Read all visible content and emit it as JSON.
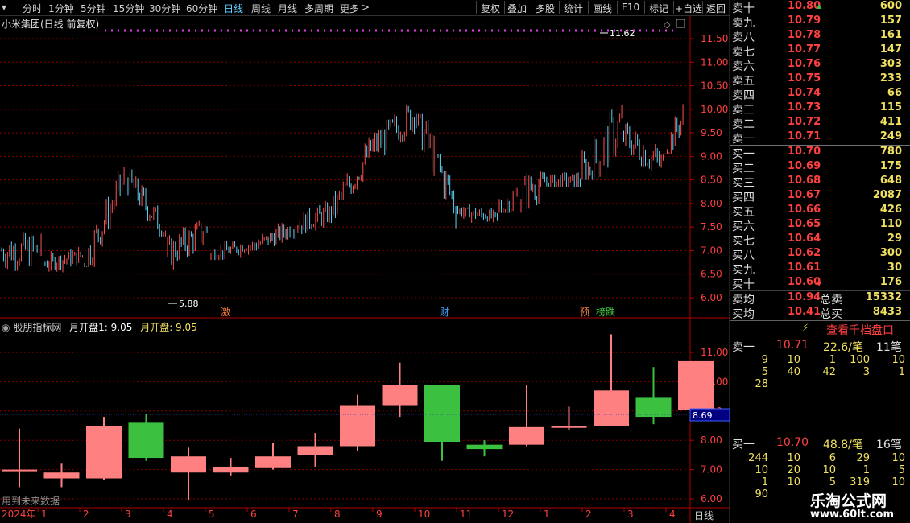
{
  "toolbar": {
    "periods": [
      "分时",
      "1分钟",
      "5分钟",
      "15分钟",
      "30分钟",
      "60分钟",
      "日线",
      "周线",
      "月线",
      "多周期",
      "更多"
    ],
    "active_period": "日线",
    "more_arrow": ">",
    "right_buttons": [
      "复权",
      "叠加",
      "多股",
      "统计",
      "画线",
      "F10",
      "标记",
      "+自选",
      "返回"
    ]
  },
  "main_chart": {
    "title": "小米集团(日线 前复权)",
    "y_ticks": [
      "11.50",
      "11.00",
      "10.50",
      "10.00",
      "9.50",
      "9.00",
      "8.50",
      "8.00",
      "7.50",
      "7.00",
      "6.50",
      "6.00"
    ],
    "high_label": "11.62",
    "low_label": "5.88",
    "event_markers": [
      "激",
      "财",
      "预",
      "榜跌"
    ]
  },
  "indicator_chart": {
    "title": "股朋指标网",
    "label1": "月开盘1: 9.05",
    "label2": "月开盘: 9.05",
    "y_ticks": [
      "11.00",
      "10.00",
      "9.00",
      "8.00",
      "7.00",
      "6.00"
    ],
    "current_value": "8.69",
    "footer_note": "用到未来数据",
    "x_year": "2024年",
    "x_months": [
      "1",
      "2",
      "3",
      "4",
      "5",
      "6",
      "7",
      "8",
      "9",
      "10",
      "11",
      "12",
      "1",
      "2",
      "3",
      "4"
    ],
    "period_button": "日线"
  },
  "chart_data": {
    "type": "candlestick",
    "monthly": [
      {
        "o": 7.0,
        "c": 7.0,
        "h": 8.4,
        "l": 6.4
      },
      {
        "o": 6.7,
        "c": 6.9,
        "h": 7.2,
        "l": 6.4
      },
      {
        "o": 6.7,
        "c": 8.5,
        "h": 8.8,
        "l": 6.65
      },
      {
        "o": 8.6,
        "c": 7.4,
        "h": 8.9,
        "l": 7.3
      },
      {
        "o": 6.9,
        "c": 7.45,
        "h": 7.75,
        "l": 5.95
      },
      {
        "o": 6.9,
        "c": 7.1,
        "h": 7.4,
        "l": 6.8
      },
      {
        "o": 7.05,
        "c": 7.45,
        "h": 7.9,
        "l": 7.0
      },
      {
        "o": 7.5,
        "c": 7.8,
        "h": 8.25,
        "l": 7.1
      },
      {
        "o": 7.8,
        "c": 9.2,
        "h": 9.55,
        "l": 7.65
      },
      {
        "o": 9.2,
        "c": 9.9,
        "h": 10.65,
        "l": 8.8
      },
      {
        "o": 9.9,
        "c": 7.95,
        "h": 9.9,
        "l": 7.3
      },
      {
        "o": 7.85,
        "c": 7.7,
        "h": 8.0,
        "l": 7.45
      },
      {
        "o": 7.85,
        "c": 8.45,
        "h": 9.9,
        "l": 7.8
      },
      {
        "o": 8.45,
        "c": 8.48,
        "h": 9.15,
        "l": 8.35
      },
      {
        "o": 8.5,
        "c": 9.7,
        "h": 11.62,
        "l": 8.5
      },
      {
        "o": 9.45,
        "c": 8.8,
        "h": 10.5,
        "l": 8.55
      },
      {
        "o": 9.05,
        "c": 10.7,
        "h": 10.7,
        "l": 9.05
      }
    ],
    "main_range": [
      5.88,
      11.62
    ]
  },
  "order_book": {
    "asks": [
      {
        "label": "卖十",
        "price": "10.80",
        "vol": "600"
      },
      {
        "label": "卖九",
        "price": "10.79",
        "vol": "157"
      },
      {
        "label": "卖八",
        "price": "10.78",
        "vol": "161"
      },
      {
        "label": "卖七",
        "price": "10.77",
        "vol": "147"
      },
      {
        "label": "卖六",
        "price": "10.76",
        "vol": "303"
      },
      {
        "label": "卖五",
        "price": "10.75",
        "vol": "233"
      },
      {
        "label": "卖四",
        "price": "10.74",
        "vol": "66"
      },
      {
        "label": "卖三",
        "price": "10.73",
        "vol": "115"
      },
      {
        "label": "卖二",
        "price": "10.72",
        "vol": "411"
      },
      {
        "label": "卖一",
        "price": "10.71",
        "vol": "249"
      }
    ],
    "bids": [
      {
        "label": "买一",
        "price": "10.70",
        "vol": "780"
      },
      {
        "label": "买二",
        "price": "10.69",
        "vol": "175"
      },
      {
        "label": "买三",
        "price": "10.68",
        "vol": "648"
      },
      {
        "label": "买四",
        "price": "10.67",
        "vol": "2087"
      },
      {
        "label": "买五",
        "price": "10.66",
        "vol": "426"
      },
      {
        "label": "买六",
        "price": "10.65",
        "vol": "110"
      },
      {
        "label": "买七",
        "price": "10.64",
        "vol": "29"
      },
      {
        "label": "买八",
        "price": "10.62",
        "vol": "300"
      },
      {
        "label": "买九",
        "price": "10.61",
        "vol": "30"
      },
      {
        "label": "买十",
        "price": "10.60",
        "vol": "176"
      }
    ],
    "avg_ask_label": "卖均",
    "avg_ask": "10.94",
    "total_ask_label": "总卖",
    "total_ask": "15332",
    "avg_bid_label": "买均",
    "avg_bid": "10.41",
    "total_bid_label": "总买",
    "total_bid": "8433"
  },
  "queue_panel": {
    "title": "查看千档盘口",
    "ask_label": "卖一",
    "ask_price": "10.71",
    "ask_avg": "22.6/笔",
    "ask_count": "11笔",
    "ask_queue": [
      [
        "9",
        "10",
        "1",
        "100",
        "10"
      ],
      [
        "5",
        "40",
        "42",
        "3",
        "1"
      ],
      [
        "28",
        "",
        "",
        "",
        ""
      ]
    ],
    "bid_label": "买一",
    "bid_price": "10.70",
    "bid_avg": "48.8/笔",
    "bid_count": "16笔",
    "bid_queue": [
      [
        "244",
        "10",
        "6",
        "29",
        "10"
      ],
      [
        "10",
        "20",
        "10",
        "1",
        "5"
      ],
      [
        "1",
        "10",
        "5",
        "319",
        "10"
      ],
      [
        "90",
        "",
        "",
        "",
        ""
      ]
    ]
  },
  "watermark": {
    "line1": "乐淘公式网",
    "line2": "www.60lt.com"
  },
  "colors": {
    "up": "#ff5050",
    "down": "#5fd0f0",
    "up_box": "#ff8080",
    "down_box": "#3cc040",
    "grid": "#800000",
    "axis": "#b00000"
  }
}
